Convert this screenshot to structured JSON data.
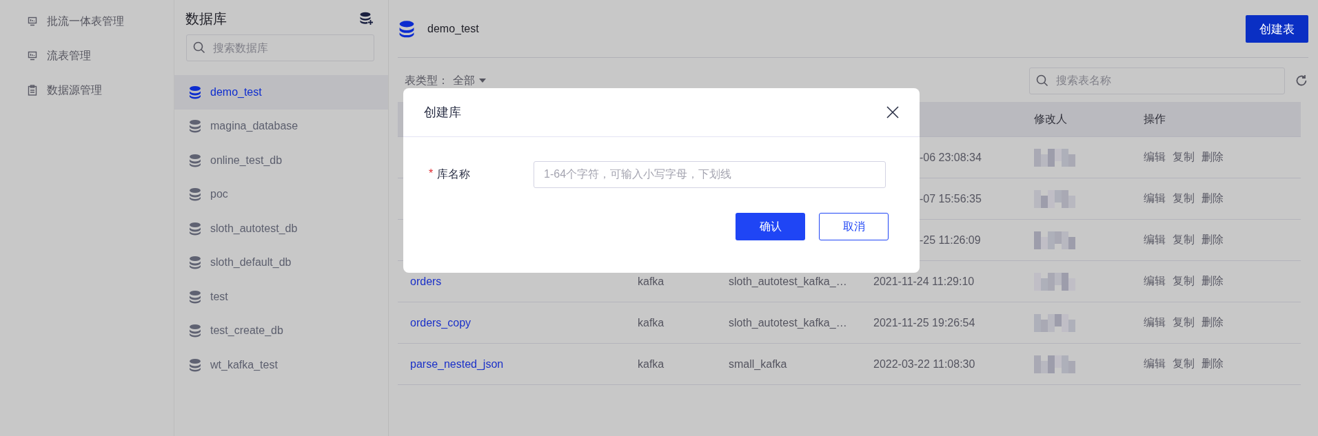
{
  "nav": {
    "items": [
      {
        "label": "批流一体表管理",
        "kind": "monitor"
      },
      {
        "label": "流表管理",
        "kind": "monitor"
      },
      {
        "label": "数据源管理",
        "kind": "clipboard"
      }
    ]
  },
  "databases": {
    "title": "数据库",
    "search": {
      "placeholder": "搜索数据库"
    },
    "items": [
      {
        "name": "demo_test",
        "selected": true
      },
      {
        "name": "magina_database",
        "selected": false
      },
      {
        "name": "online_test_db",
        "selected": false
      },
      {
        "name": "poc",
        "selected": false
      },
      {
        "name": "sloth_autotest_db",
        "selected": false
      },
      {
        "name": "sloth_default_db",
        "selected": false
      },
      {
        "name": "test",
        "selected": false
      },
      {
        "name": "test_create_db",
        "selected": false
      },
      {
        "name": "wt_kafka_test",
        "selected": false
      }
    ]
  },
  "main": {
    "database": "demo_test",
    "create_button": "创建表",
    "filter": {
      "label": "表类型：",
      "value": "全部"
    },
    "search": {
      "placeholder": "搜索表名称"
    },
    "table": {
      "columns": {
        "modified_by": "修改人",
        "actions": "操作"
      },
      "rows": [
        {
          "modified": "-06 23:08:34",
          "actions": [
            "编辑",
            "复制",
            "删除"
          ]
        },
        {
          "modified": "-07 15:56:35",
          "actions": [
            "编辑",
            "复制",
            "删除"
          ]
        },
        {
          "modified": "-25 11:26:09",
          "actions": [
            "编辑",
            "复制",
            "删除"
          ]
        },
        {
          "name": "orders",
          "type": "kafka",
          "source": "sloth_autotest_kafka_…",
          "modified": "2021-11-24 11:29:10",
          "actions": [
            "编辑",
            "复制",
            "删除"
          ]
        },
        {
          "name": "orders_copy",
          "type": "kafka",
          "source": "sloth_autotest_kafka_…",
          "modified": "2021-11-25 19:26:54",
          "actions": [
            "编辑",
            "复制",
            "删除"
          ]
        },
        {
          "name": "parse_nested_json",
          "type": "kafka",
          "source": "small_kafka",
          "modified": "2022-03-22 11:08:30",
          "actions": [
            "编辑",
            "复制",
            "删除"
          ]
        }
      ]
    }
  },
  "dialog": {
    "title": "创建库",
    "field": {
      "label": "库名称",
      "required_mark": "*",
      "placeholder": "1-64个字符，可输入小写字母，下划线"
    },
    "buttons": [
      {
        "label": "确认",
        "kind": "primary"
      },
      {
        "label": "取消",
        "kind": "secondary"
      }
    ]
  }
}
